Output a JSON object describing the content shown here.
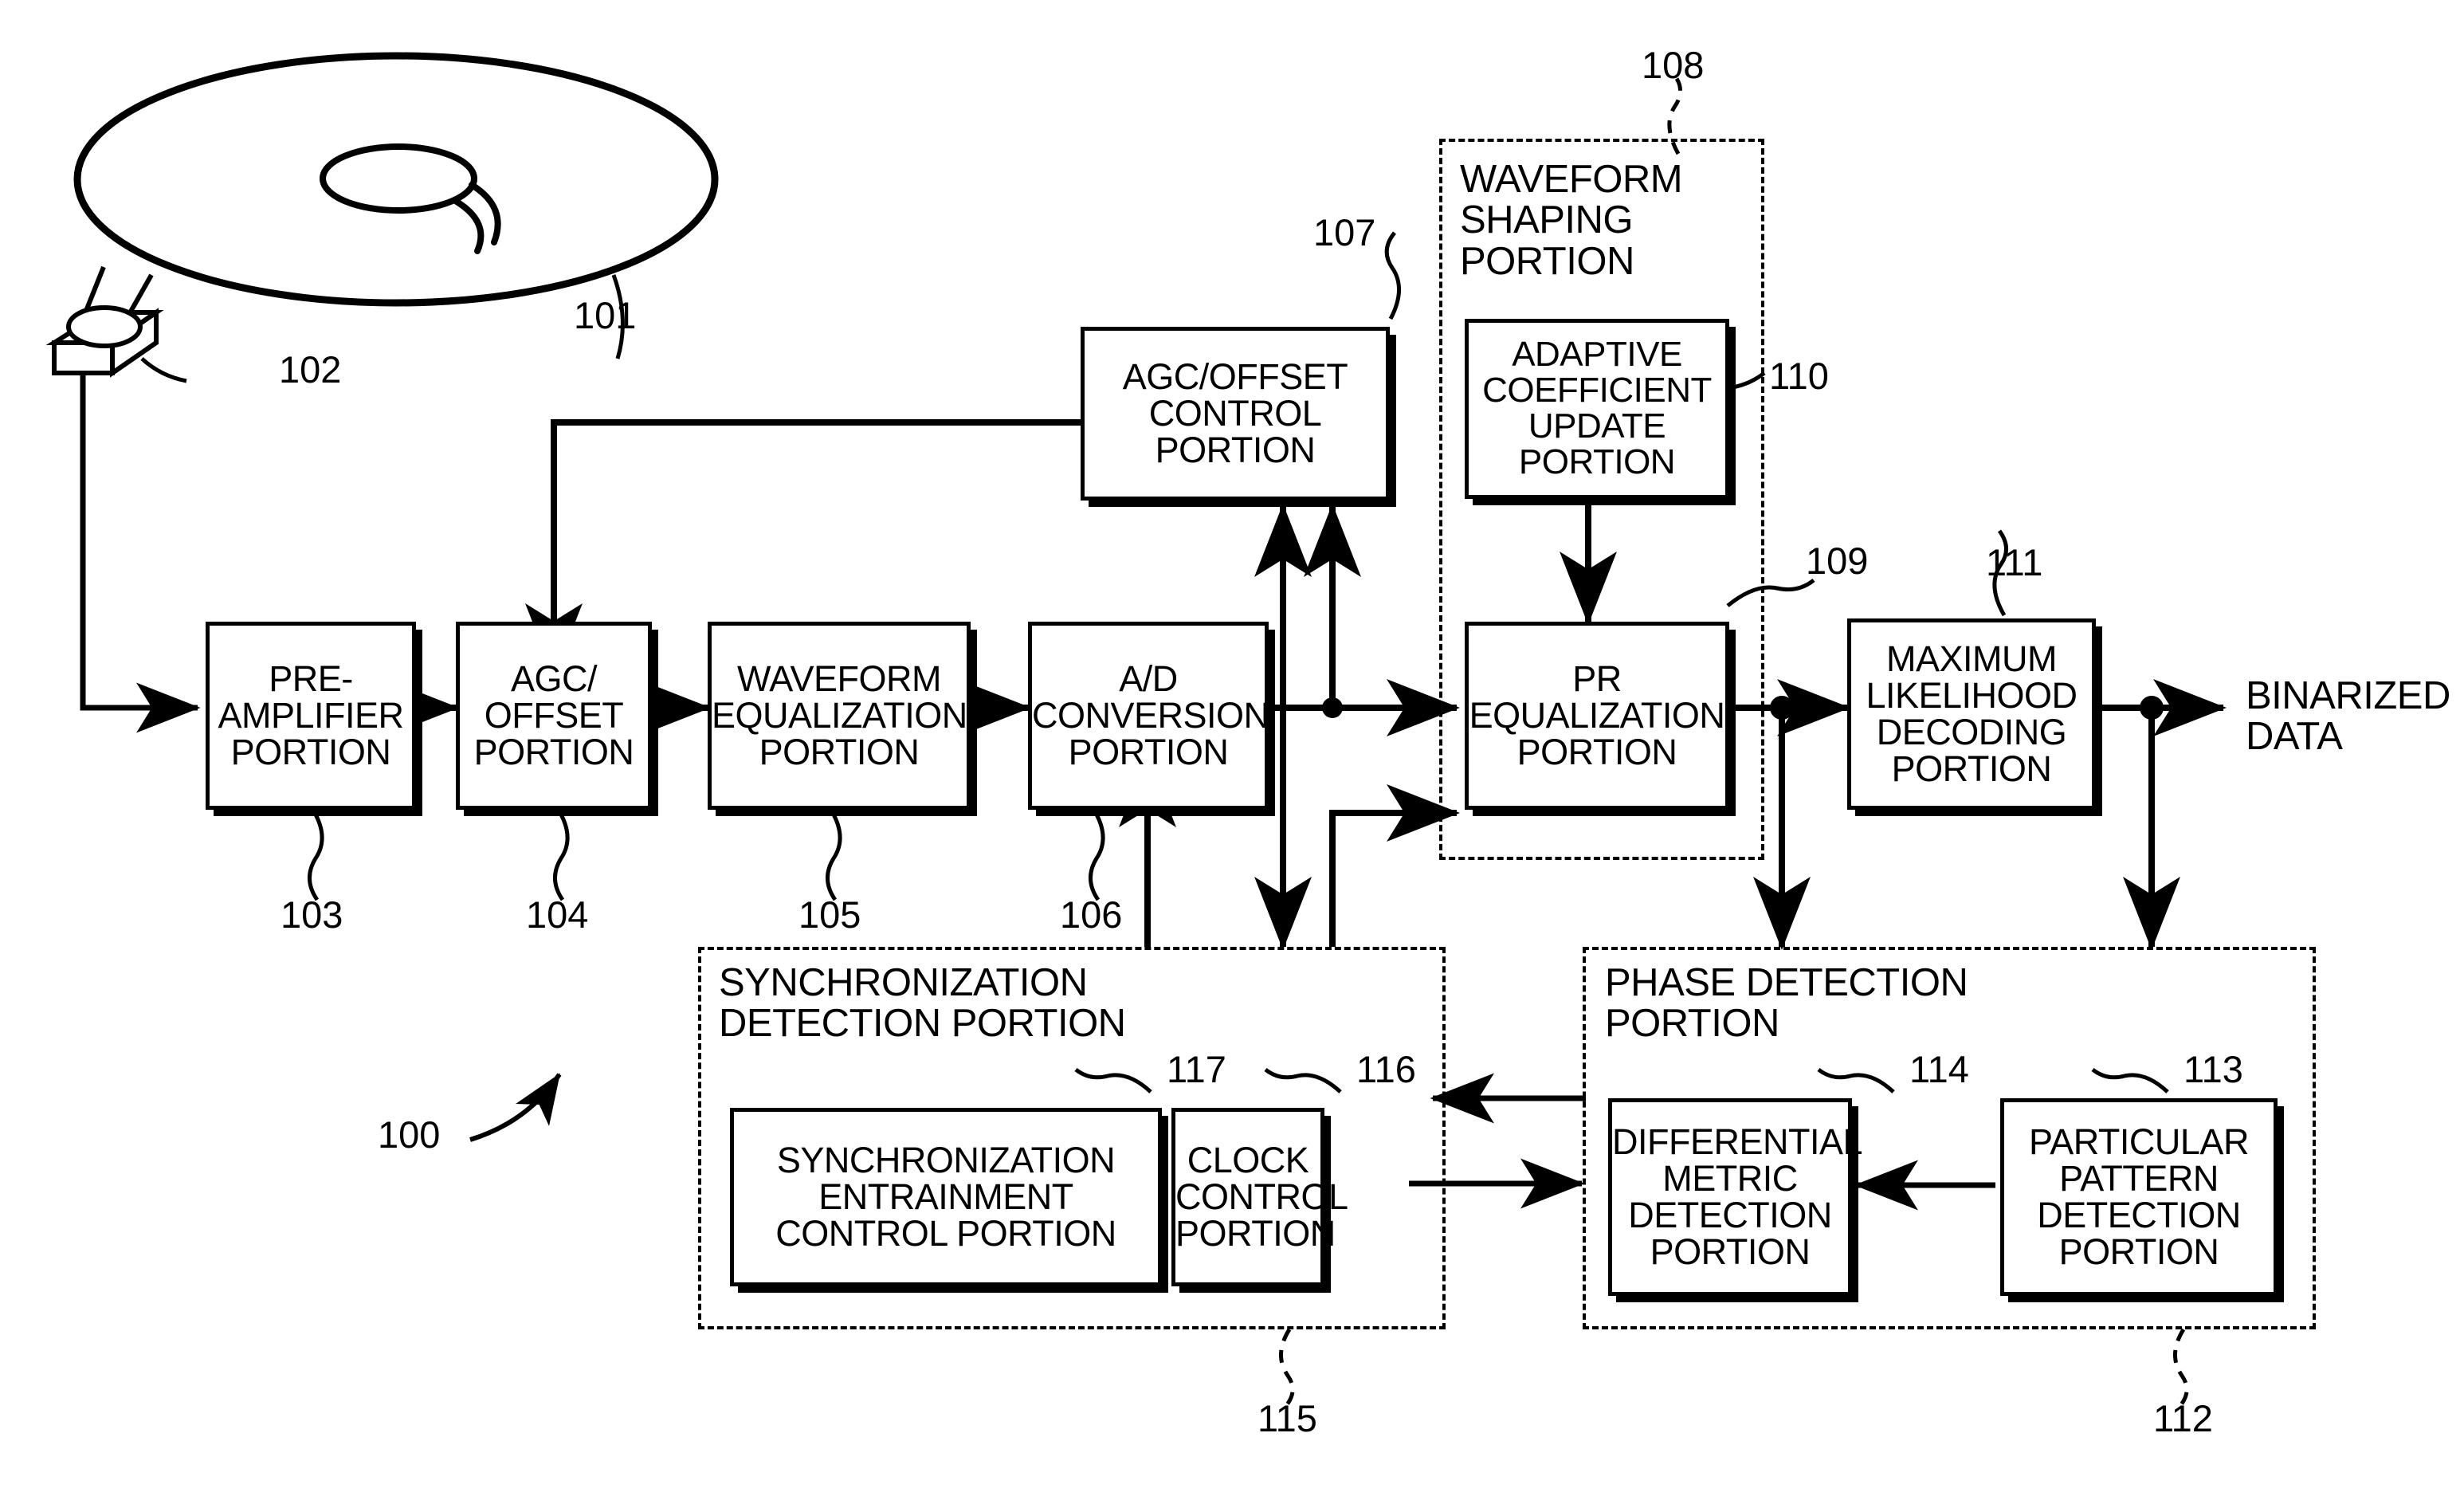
{
  "figure": {
    "type": "patent-block-diagram",
    "title": "Optical disc reproduction signal processing block diagram"
  },
  "blocks": {
    "preamp": {
      "label": "PRE-\nAMPLIFIER\nPORTION",
      "ref": "103"
    },
    "agc_offset": {
      "label": "AGC/\nOFFSET\nPORTION",
      "ref": "104"
    },
    "waveform_eq": {
      "label": "WAVEFORM\nEQUALIZATION\nPORTION",
      "ref": "105"
    },
    "ad_conv": {
      "label": "A/D\nCONVERSION\nPORTION",
      "ref": "106"
    },
    "agc_control": {
      "label": "AGC/OFFSET\nCONTROL\nPORTION",
      "ref": "107"
    },
    "adaptive_coef": {
      "label": "ADAPTIVE\nCOEFFICIENT\nUPDATE\nPORTION",
      "ref": "110"
    },
    "pr_eq": {
      "label": "PR\nEQUALIZATION\nPORTION",
      "ref": "109"
    },
    "max_likelihood": {
      "label": "MAXIMUM\nLIKELIHOOD\nDECODING\nPORTION",
      "ref": "111"
    },
    "sync_entrain": {
      "label": "SYNCHRONIZATION\nENTRAINMENT\nCONTROL PORTION",
      "ref": "117"
    },
    "clock_control": {
      "label": "CLOCK\nCONTROL\nPORTION",
      "ref": "116"
    },
    "diff_metric": {
      "label": "DIFFERENTIAL\nMETRIC\nDETECTION\nPORTION",
      "ref": "114"
    },
    "particular_pat": {
      "label": "PARTICULAR\nPATTERN\nDETECTION\nPORTION",
      "ref": "113"
    }
  },
  "groups": {
    "waveform_shaping": {
      "label": "WAVEFORM\nSHAPING\nPORTION",
      "ref": "108"
    },
    "sync_detection": {
      "label": "SYNCHRONIZATION\nDETECTION PORTION",
      "ref": "115"
    },
    "phase_detection": {
      "label": "PHASE DETECTION\nPORTION",
      "ref": "112"
    }
  },
  "parts": {
    "disc": {
      "ref": "101"
    },
    "pickup": {
      "ref": "102"
    },
    "system": {
      "ref": "100"
    }
  },
  "signals": {
    "output": "BINARIZED\nDATA"
  },
  "colors": {
    "ink": "#000000",
    "paper": "#ffffff"
  }
}
